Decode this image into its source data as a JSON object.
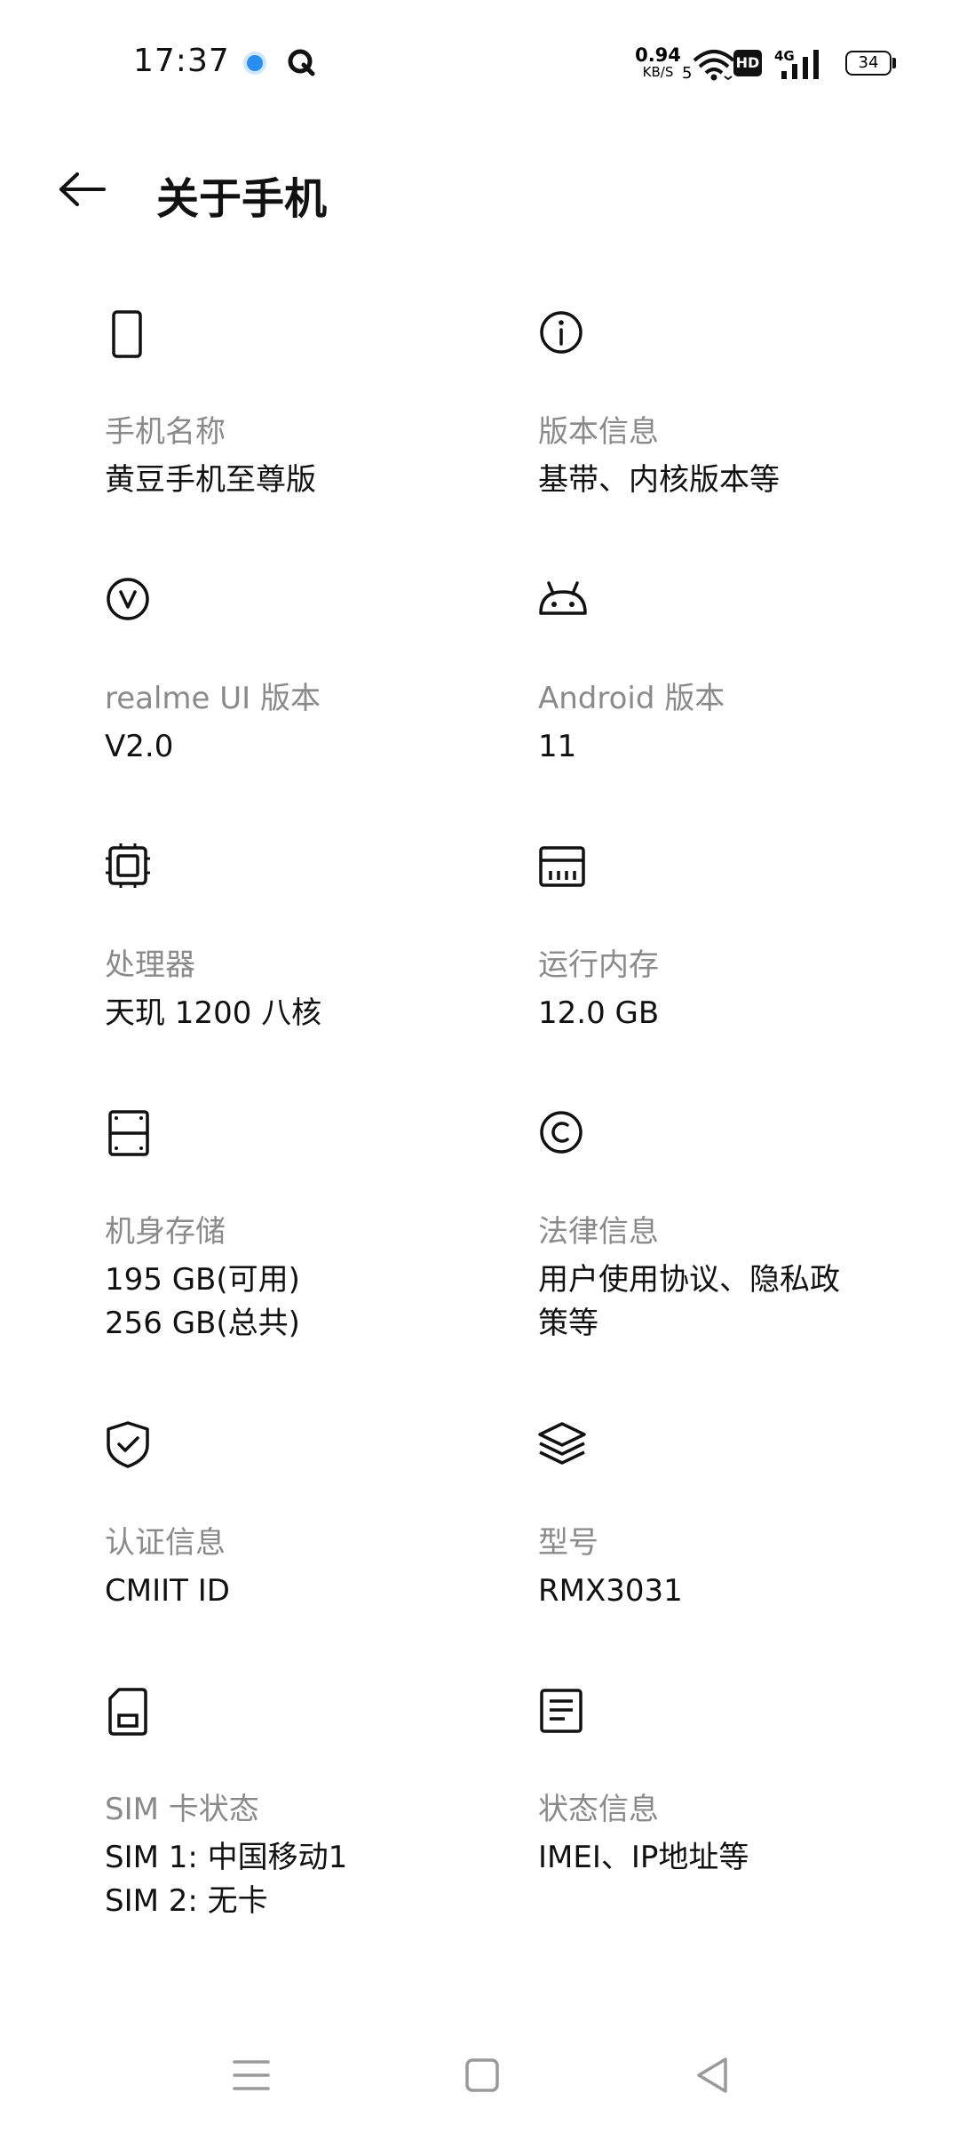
{
  "status_bar": {
    "time": "17:37",
    "net_speed_value": "0.94",
    "net_speed_unit": "KB/S",
    "wifi_badge": "5",
    "hd_badge": "HD",
    "cell_badge": "4G",
    "battery": "34"
  },
  "header": {
    "title": "关于手机"
  },
  "tiles": [
    {
      "icon": "phone-icon",
      "label": "手机名称",
      "value": "黄豆手机至尊版"
    },
    {
      "icon": "info-icon",
      "label": "版本信息",
      "value": "基带、内核版本等"
    },
    {
      "icon": "realme-v-icon",
      "label": "realme UI 版本",
      "value": "V2.0"
    },
    {
      "icon": "android-icon",
      "label": "Android 版本",
      "value": "11"
    },
    {
      "icon": "processor-icon",
      "label": "处理器",
      "value": "天玑 1200 八核"
    },
    {
      "icon": "memory-icon",
      "label": "运行内存",
      "value": "12.0 GB"
    },
    {
      "icon": "storage-icon",
      "label": "机身存储",
      "value": "195 GB(可用)\n256 GB(总共)"
    },
    {
      "icon": "copyright-icon",
      "label": "法律信息",
      "value": "用户使用协议、隐私政\n策等"
    },
    {
      "icon": "shield-check-icon",
      "label": "认证信息",
      "value": "CMIIT ID"
    },
    {
      "icon": "layers-icon",
      "label": "型号",
      "value": "RMX3031"
    },
    {
      "icon": "sim-card-icon",
      "label": "SIM 卡状态",
      "value": "SIM 1: 中国移动1\nSIM 2: 无卡"
    },
    {
      "icon": "document-icon",
      "label": "状态信息",
      "value": "IMEI、IP地址等"
    }
  ],
  "nav_bar": {
    "buttons": [
      "menu-icon",
      "home-icon",
      "back-triangle-icon"
    ]
  }
}
